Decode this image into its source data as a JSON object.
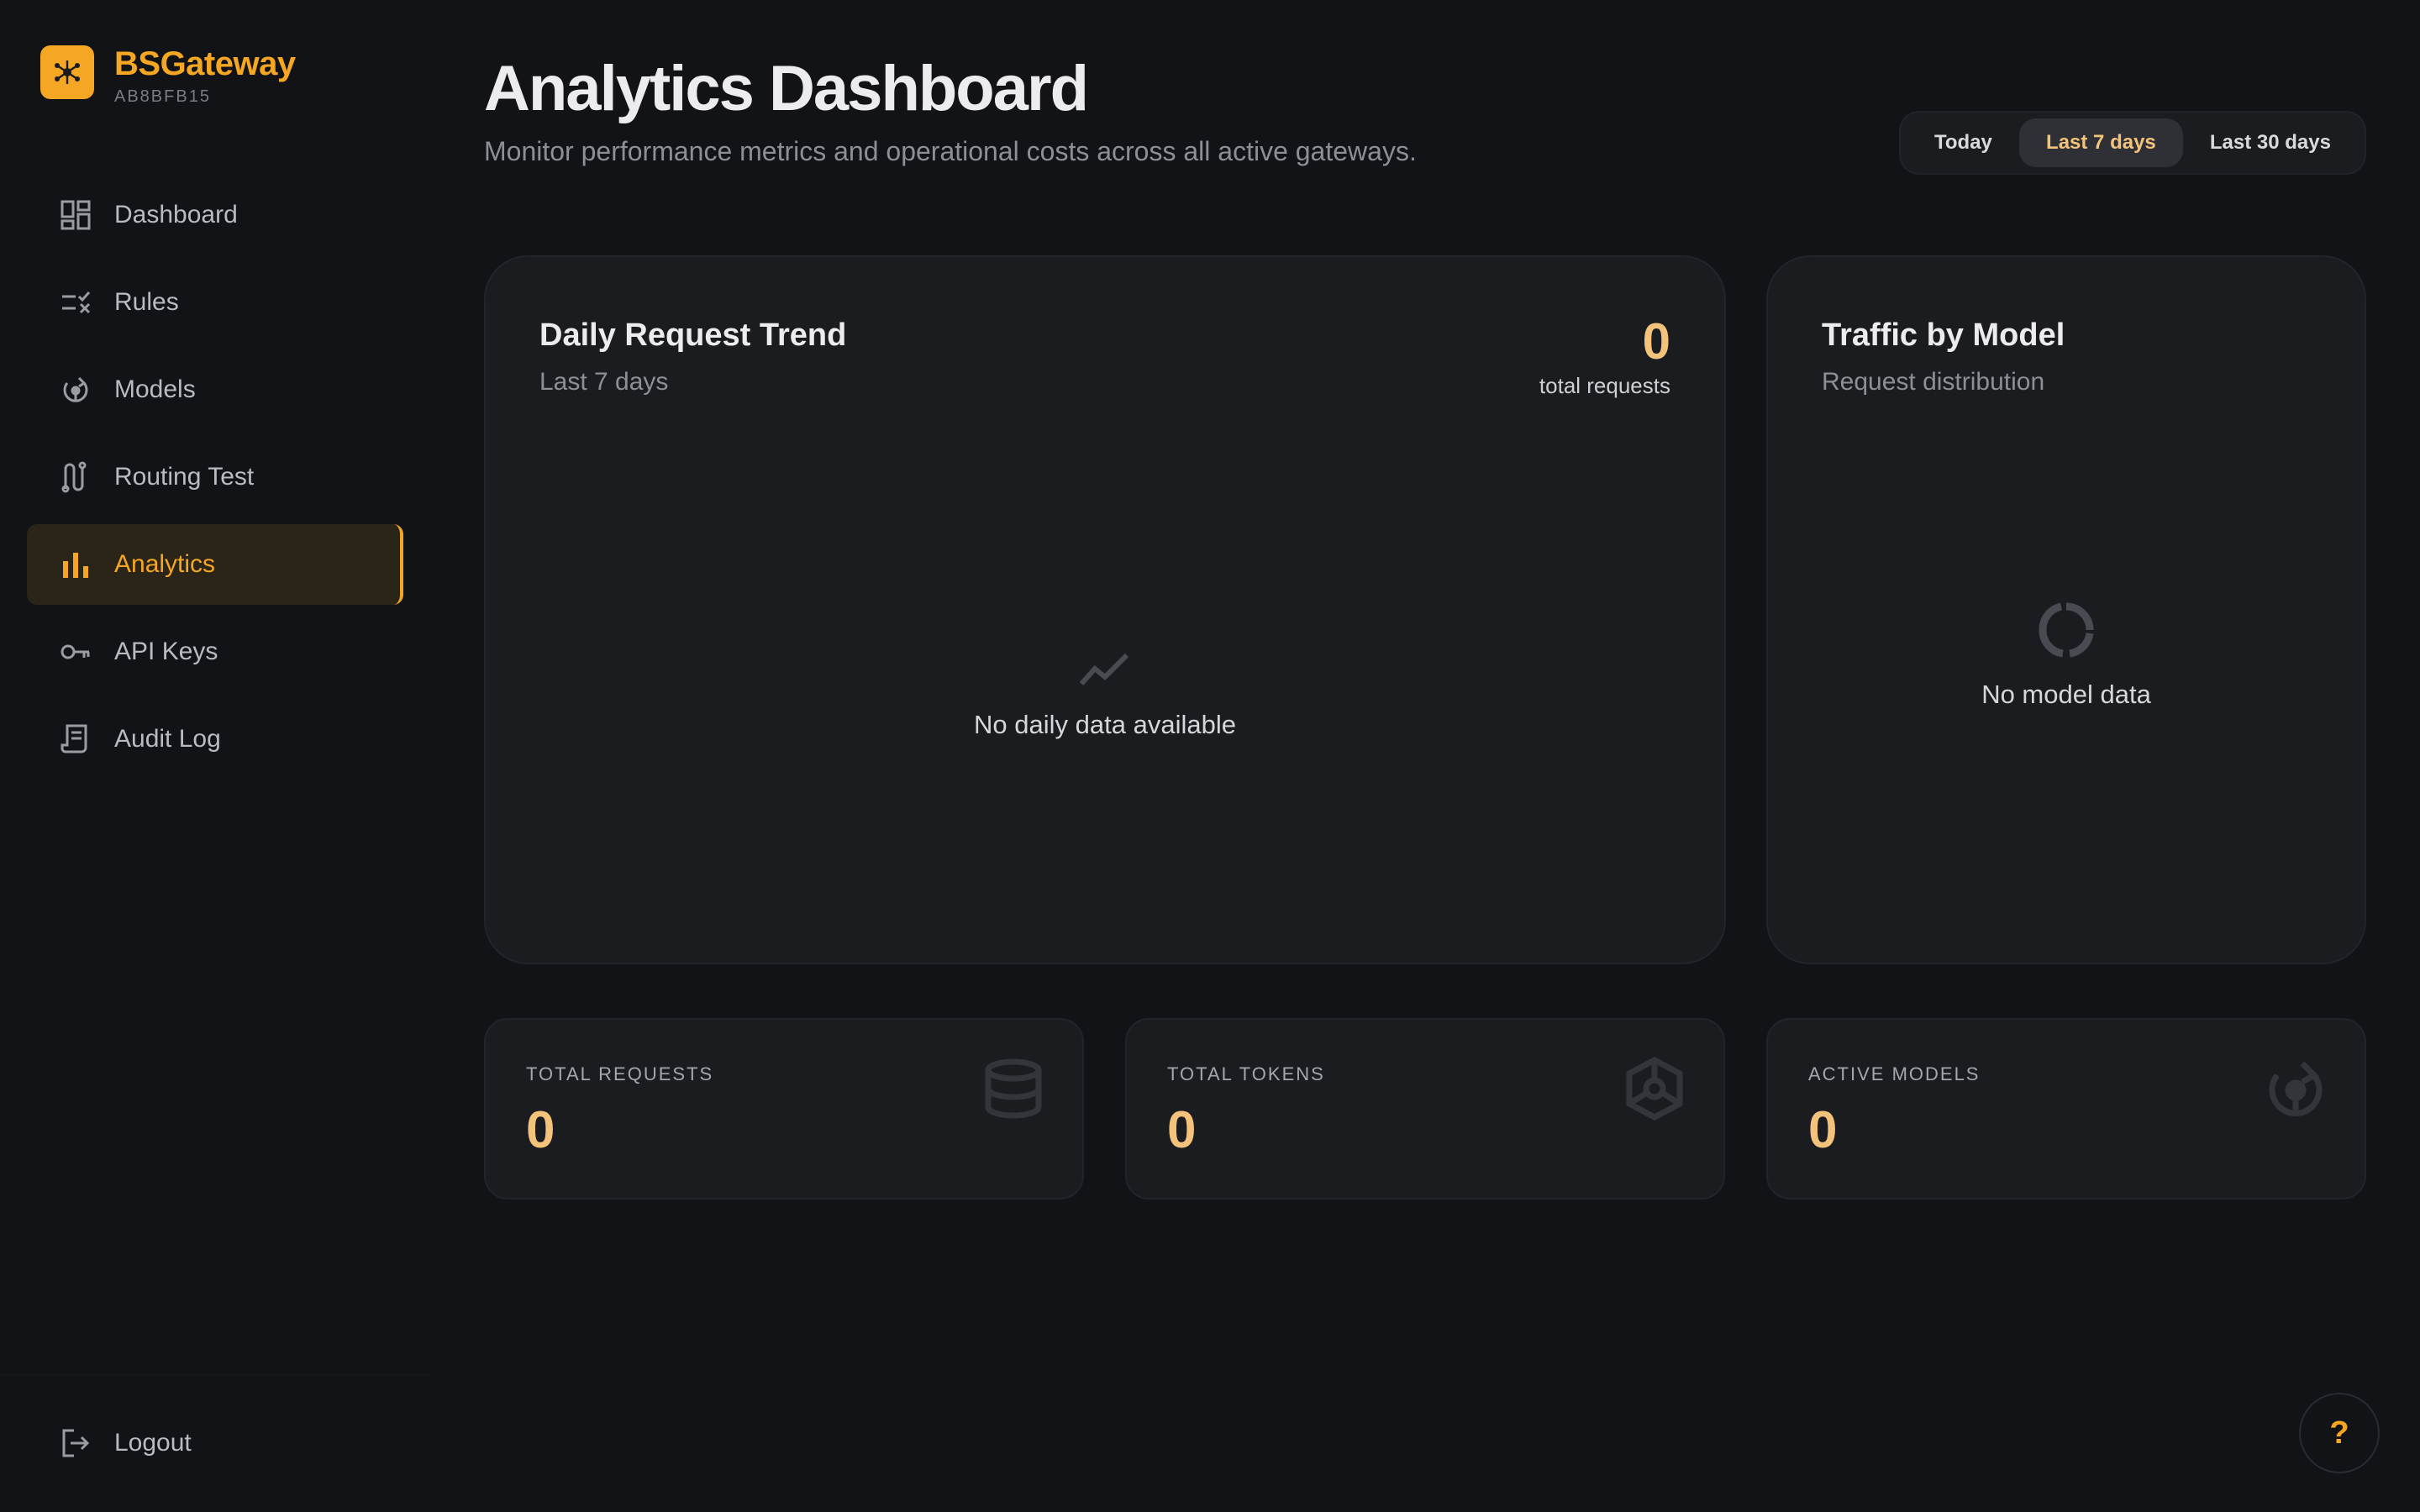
{
  "brand": {
    "name": "BSGateway",
    "id": "AB8BFB15"
  },
  "nav": {
    "items": [
      {
        "label": "Dashboard",
        "icon": "dashboard-icon"
      },
      {
        "label": "Rules",
        "icon": "rules-icon"
      },
      {
        "label": "Models",
        "icon": "models-icon"
      },
      {
        "label": "Routing Test",
        "icon": "routing-icon"
      },
      {
        "label": "Analytics",
        "icon": "analytics-icon",
        "active": true
      },
      {
        "label": "API Keys",
        "icon": "key-icon"
      },
      {
        "label": "Audit Log",
        "icon": "receipt-icon"
      }
    ],
    "logout": "Logout"
  },
  "header": {
    "title": "Analytics Dashboard",
    "subtitle": "Monitor performance metrics and operational costs across all active gateways."
  },
  "range": {
    "options": [
      "Today",
      "Last 7 days",
      "Last 30 days"
    ],
    "selected": "Last 7 days"
  },
  "trend": {
    "title": "Daily Request Trend",
    "subtitle": "Last 7 days",
    "total": "0",
    "total_label": "total requests",
    "empty": "No daily data available"
  },
  "model_traffic": {
    "title": "Traffic by Model",
    "subtitle": "Request distribution",
    "empty": "No model data"
  },
  "stats": [
    {
      "label": "TOTAL REQUESTS",
      "value": "0",
      "icon": "database-icon"
    },
    {
      "label": "TOTAL TOKENS",
      "value": "0",
      "icon": "cube-icon"
    },
    {
      "label": "ACTIVE MODELS",
      "value": "0",
      "icon": "models-icon"
    }
  ],
  "help": "?",
  "colors": {
    "accent": "#f5a623",
    "value": "#f3c37b",
    "background": "#121317",
    "card": "#1b1c20"
  }
}
